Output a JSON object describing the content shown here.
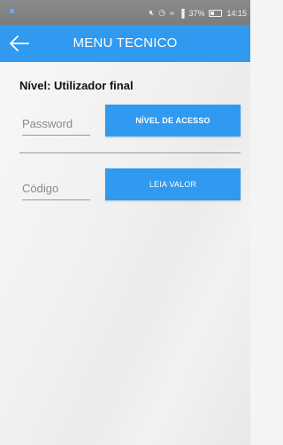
{
  "status_bar": {
    "battery": "37%",
    "time": "14:15"
  },
  "app_bar": {
    "title": "MENU TECNICO",
    "back_icon": "arrow-left-icon"
  },
  "main": {
    "level_text": "Nível: Utilizador final",
    "password_placeholder": "Password",
    "access_button_label": "NÍVEL DE ACESSO",
    "code_placeholder": "Código",
    "read_button_label": "LEIA VALOR"
  },
  "colors": {
    "accent": "#2f9af0",
    "status_bar": "#808080"
  }
}
